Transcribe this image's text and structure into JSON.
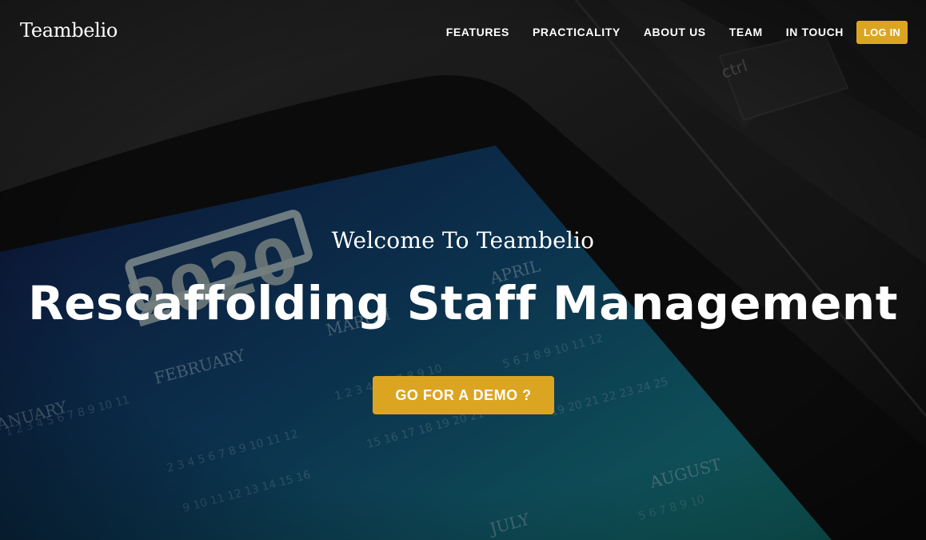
{
  "brand": {
    "name": "Teambelio"
  },
  "nav": {
    "items": [
      {
        "label": "FEATURES"
      },
      {
        "label": "PRACTICALITY"
      },
      {
        "label": "ABOUT US"
      },
      {
        "label": "TEAM"
      },
      {
        "label": "IN TOUCH"
      }
    ],
    "login_label": "LOG IN"
  },
  "hero": {
    "welcome": "Welcome To Teambelio",
    "headline": "Rescaffolding Staff Management",
    "cta_label": "GO FOR A DEMO ?"
  },
  "background": {
    "calendar_year": "2020",
    "key_label": "ctrl",
    "months": [
      "JANUARY",
      "FEBRUARY",
      "MARCH",
      "APRIL",
      "JULY",
      "AUGUST"
    ]
  },
  "colors": {
    "accent": "#dba522",
    "text": "#ffffff",
    "screen_dark": "#0d2a48",
    "screen_light": "#1a7a7a",
    "bezel": "#0e0e0e"
  }
}
